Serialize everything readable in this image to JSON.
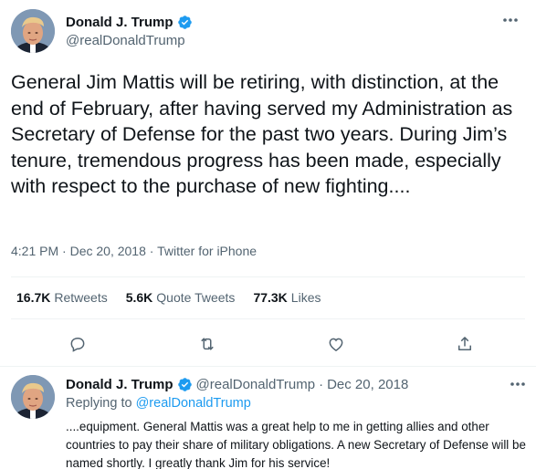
{
  "tweet": {
    "author": {
      "display_name": "Donald J. Trump",
      "handle": "@realDonaldTrump",
      "verified_icon": "verified-badge-icon"
    },
    "text": "General Jim Mattis will be retiring, with distinction, at the end of February, after having served my Administration as Secretary of Defense for the past two years. During Jim’s tenure, tremendous progress has been made, especially with respect to the purchase of new fighting....",
    "time": "4:21 PM",
    "date": "Dec 20, 2018",
    "source": "Twitter for iPhone",
    "separator": "·",
    "stats": {
      "retweets_count": "16.7K",
      "retweets_label": "Retweets",
      "quotes_count": "5.6K",
      "quotes_label": "Quote Tweets",
      "likes_count": "77.3K",
      "likes_label": "Likes"
    },
    "actions": [
      "reply-icon",
      "retweet-icon",
      "like-icon",
      "share-icon"
    ]
  },
  "reply": {
    "display_name": "Donald J. Trump",
    "handle": "@realDonaldTrump",
    "separator": "·",
    "date": "Dec 20, 2018",
    "replying_prefix": "Replying to",
    "replying_handle": "@realDonaldTrump",
    "text": "....equipment. General Mattis was a great help to me in getting allies and other countries to pay their share of military obligations. A new Secretary of Defense will be named shortly. I greatly thank Jim for his service!"
  },
  "colors": {
    "accent": "#1d9bf0",
    "text": "#0f1419",
    "secondary": "#536471",
    "divider": "#eff3f4"
  }
}
